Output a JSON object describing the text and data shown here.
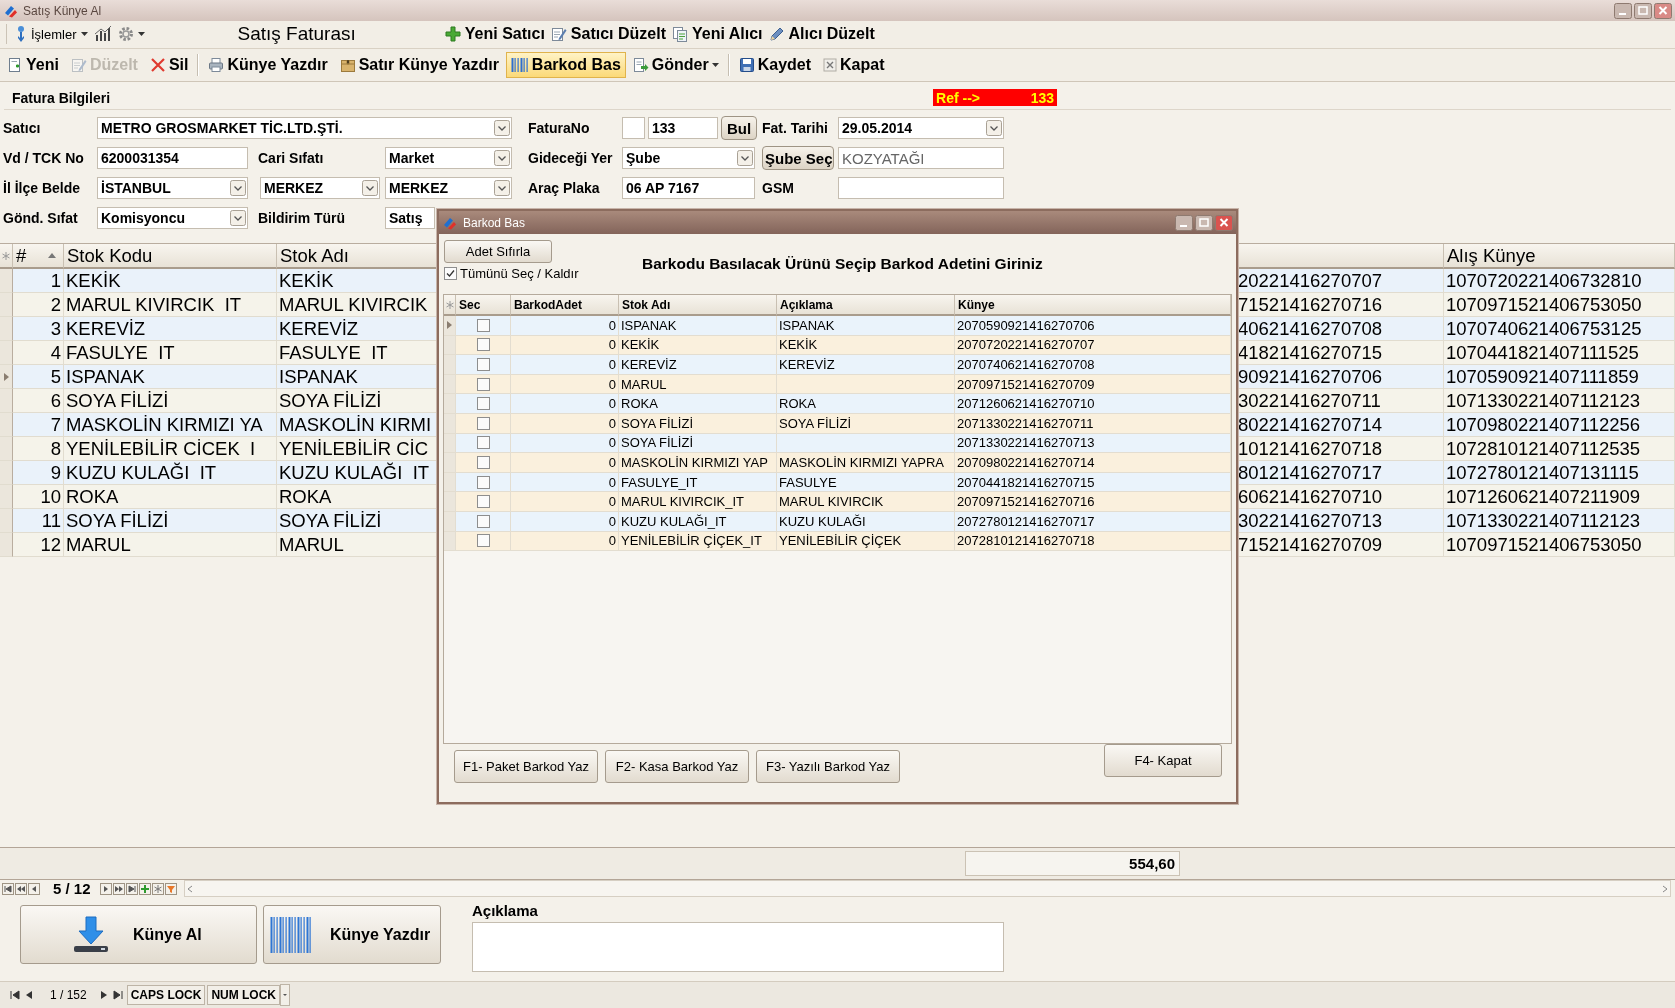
{
  "window": {
    "title": "Satış Künye Al"
  },
  "toolbar": {
    "menu": "İşlemler",
    "form_title": "Satış Faturası",
    "actions": [
      "Yeni Satıcı",
      "Satıcı Düzelt",
      "Yeni Alıcı",
      "Alıcı Düzelt"
    ]
  },
  "command_bar": [
    {
      "label": "Yeni",
      "kind": "button",
      "disabled": false,
      "highlighted": false
    },
    {
      "label": "Düzelt",
      "kind": "button",
      "disabled": true,
      "highlighted": false
    },
    {
      "label": "Sil",
      "kind": "button",
      "disabled": false,
      "highlighted": false
    },
    {
      "label": "Künye Yazdır",
      "kind": "button",
      "disabled": false,
      "highlighted": false
    },
    {
      "label": "Satır Künye Yazdır",
      "kind": "button",
      "disabled": false,
      "highlighted": false
    },
    {
      "label": "Barkod Bas",
      "kind": "button",
      "disabled": false,
      "highlighted": true
    },
    {
      "label": "Gönder",
      "kind": "dropdown",
      "disabled": false,
      "highlighted": false
    },
    {
      "label": "Kaydet",
      "kind": "button",
      "disabled": false,
      "highlighted": false
    },
    {
      "label": "Kapat",
      "kind": "button",
      "disabled": false,
      "highlighted": false
    }
  ],
  "invoice": {
    "title": "Fatura Bilgileri",
    "ref": {
      "label": "Ref -->",
      "value": "133"
    },
    "rows": [
      [
        {
          "kind": "label",
          "text": "Satıcı"
        },
        {
          "kind": "combo",
          "value": "METRO GROSMARKET TİC.LTD.ŞTİ."
        },
        "",
        "",
        {
          "kind": "label",
          "text": "FaturaNo"
        },
        {
          "kind": "number_lookup",
          "value": "133",
          "button": "Bul"
        },
        {
          "kind": "label",
          "text": "Fat. Tarihi"
        },
        {
          "kind": "combo",
          "value": "29.05.2014"
        }
      ],
      [
        {
          "kind": "label",
          "text": "Vd / TCK No"
        },
        {
          "kind": "input",
          "value": "6200031354"
        },
        {
          "kind": "label",
          "text": "Cari Sıfatı"
        },
        {
          "kind": "combo",
          "value": "Market"
        },
        {
          "kind": "label",
          "text": "Gideceği Yer"
        },
        {
          "kind": "combo",
          "value": "Şube"
        },
        {
          "kind": "button",
          "text": "Şube Seç"
        },
        {
          "kind": "readonly",
          "value": "KOZYATAĞI"
        }
      ],
      [
        {
          "kind": "label",
          "text": "İl İlçe Belde"
        },
        {
          "kind": "combo",
          "value": "İSTANBUL"
        },
        {
          "kind": "combo",
          "value": "MERKEZ"
        },
        {
          "kind": "combo",
          "value": "MERKEZ"
        },
        {
          "kind": "label",
          "text": "Araç Plaka"
        },
        {
          "kind": "input",
          "value": "06 AP 7167"
        },
        {
          "kind": "label",
          "text": "GSM"
        },
        {
          "kind": "input"
        }
      ],
      [
        {
          "kind": "label",
          "text": "Gönd. Sıfat"
        },
        {
          "kind": "combo",
          "value": "Komisyoncu"
        },
        {
          "kind": "label",
          "text": "Bildirim Türü"
        },
        {
          "kind": "combo",
          "value": "Satış"
        }
      ]
    ]
  },
  "grid": {
    "columns": [
      {
        "title": "#",
        "sorted": true
      },
      {
        "title": "Stok Kodu",
        "sorted": false
      },
      {
        "title": "Stok Adı",
        "sorted": false
      },
      {
        "title": "Alış Künye",
        "sorted": false
      }
    ],
    "rows": [
      {
        "no": "1",
        "stok_kodu": "KEKİK",
        "stok_adi": "KEKİK",
        "column_4": "20221416270707",
        "alis_kunye": "1070720221406732810",
        "current": false
      },
      {
        "no": "2",
        "stok_kodu": "MARUL KIVIRCIK  IT",
        "stok_adi": "MARUL KIVIRCIK",
        "column_4": "71521416270716",
        "alis_kunye": "1070971521406753050",
        "current": false
      },
      {
        "no": "3",
        "stok_kodu": "KEREVİZ",
        "stok_adi": "KEREVİZ",
        "column_4": "40621416270708",
        "alis_kunye": "1070740621406753125",
        "current": false
      },
      {
        "no": "4",
        "stok_kodu": "FASULYE  IT",
        "stok_adi": "FASULYE  IT",
        "column_4": "41821416270715",
        "alis_kunye": "1070441821407111525",
        "current": false
      },
      {
        "no": "5",
        "stok_kodu": "ISPANAK",
        "stok_adi": "ISPANAK",
        "column_4": "90921416270706",
        "alis_kunye": "1070590921407111859",
        "current": true
      },
      {
        "no": "6",
        "stok_kodu": "SOYA FİLİZİ",
        "stok_adi": "SOYA FİLİZİ",
        "column_4": "30221416270711",
        "alis_kunye": "1071330221407112123",
        "current": false
      },
      {
        "no": "7",
        "stok_kodu": "MASKOLİN KIRMIZI YA",
        "stok_adi": "MASKOLİN KIRMI",
        "column_4": "80221416270714",
        "alis_kunye": "1070980221407112256",
        "current": false
      },
      {
        "no": "8",
        "stok_kodu": "YENİLEBİLİR CİCEK  I",
        "stok_adi": "YENİLEBİLİR CİC",
        "column_4": "10121416270718",
        "alis_kunye": "1072810121407112535",
        "current": false
      },
      {
        "no": "9",
        "stok_kodu": "KUZU KULAĞI  IT",
        "stok_adi": "KUZU KULAĞI  IT",
        "column_4": "80121416270717",
        "alis_kunye": "1072780121407131115",
        "current": false
      },
      {
        "no": "10",
        "stok_kodu": "ROKA",
        "stok_adi": "ROKA",
        "column_4": "60621416270710",
        "alis_kunye": "1071260621407211909",
        "current": false
      },
      {
        "no": "11",
        "stok_kodu": "SOYA FİLİZİ",
        "stok_adi": "SOYA FİLİZİ",
        "column_4": "30221416270713",
        "alis_kunye": "1071330221407112123",
        "current": false
      },
      {
        "no": "12",
        "stok_kodu": "MARUL",
        "stok_adi": "MARUL",
        "column_4": "71521416270709",
        "alis_kunye": "1070971521406753050",
        "current": false
      }
    ]
  },
  "footer": {
    "total": "554,60",
    "record_position": "5 / 12"
  },
  "bottom": {
    "buttons": [
      "Künye Al",
      "Künye Yazdır"
    ],
    "note_label": "Açıklama"
  },
  "status_bar": {
    "page": "1 / 152",
    "indicators": [
      "CAPS LOCK",
      "NUM LOCK"
    ]
  },
  "dialog": {
    "title": "Barkod Bas",
    "reset_button": "Adet Sıfırla",
    "select_all": {
      "label": "Tümünü Seç / Kaldır",
      "checked": true
    },
    "heading": "Barkodu Basılacak Ürünü Seçip Barkod Adetini Giriniz",
    "table": {
      "columns": [
        "Sec",
        "BarkodAdet",
        "Stok Adı",
        "Açıklama",
        "Künye"
      ],
      "rows": [
        {
          "checked": false,
          "count": "0",
          "stok_adi": "ISPANAK",
          "aciklama": "ISPANAK",
          "kunye": "2070590921416270706",
          "current": true
        },
        {
          "checked": false,
          "count": "0",
          "stok_adi": "KEKİK",
          "aciklama": "KEKİK",
          "kunye": "2070720221416270707",
          "current": false
        },
        {
          "checked": false,
          "count": "0",
          "stok_adi": "KEREVİZ",
          "aciklama": "KEREVİZ",
          "kunye": "2070740621416270708",
          "current": false
        },
        {
          "checked": false,
          "count": "0",
          "stok_adi": "MARUL",
          "kunye": "2070971521416270709",
          "current": false
        },
        {
          "checked": false,
          "count": "0",
          "stok_adi": "ROKA",
          "aciklama": "ROKA",
          "kunye": "2071260621416270710",
          "current": false
        },
        {
          "checked": false,
          "count": "0",
          "stok_adi": "SOYA FİLİZİ",
          "aciklama": "SOYA FİLİZİ",
          "kunye": "2071330221416270711",
          "current": false
        },
        {
          "checked": false,
          "count": "0",
          "stok_adi": "SOYA FİLİZİ",
          "kunye": "2071330221416270713",
          "current": false
        },
        {
          "checked": false,
          "count": "0",
          "stok_adi": "MASKOLİN KIRMIZI YAP",
          "aciklama": "MASKOLİN KIRMIZI YAPRA",
          "kunye": "2070980221416270714",
          "current": false
        },
        {
          "checked": false,
          "count": "0",
          "stok_adi": "FASULYE_IT",
          "aciklama": "FASULYE",
          "kunye": "2070441821416270715",
          "current": false
        },
        {
          "checked": false,
          "count": "0",
          "stok_adi": "MARUL KIVIRCIK_IT",
          "aciklama": "MARUL KIVIRCIK",
          "kunye": "2070971521416270716",
          "current": false
        },
        {
          "checked": false,
          "count": "0",
          "stok_adi": "KUZU KULAĞI_IT",
          "aciklama": "KUZU KULAĞI",
          "kunye": "2072780121416270717",
          "current": false
        },
        {
          "checked": false,
          "count": "0",
          "stok_adi": "YENİLEBİLİR ÇİÇEK_IT",
          "aciklama": "YENİLEBİLİR ÇİÇEK",
          "kunye": "2072810121416270718",
          "current": false
        }
      ]
    },
    "buttons": [
      "F1- Paket Barkod Yaz",
      "F2- Kasa Barkod Yaz",
      "F3- Yazılı Barkod Yaz",
      "F4- Kapat"
    ]
  }
}
